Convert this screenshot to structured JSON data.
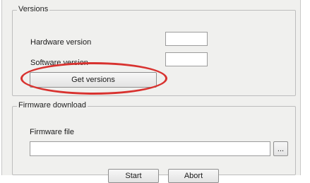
{
  "versions_group": {
    "title": "Versions",
    "hardware_label": "Hardware version",
    "hardware_value": "",
    "software_label": "Software version",
    "software_value": "",
    "get_versions_label": "Get versions"
  },
  "firmware_group": {
    "title": "Firmware download",
    "file_label": "Firmware file",
    "file_value": "",
    "browse_label": "...",
    "start_label": "Start",
    "abort_label": "Abort"
  },
  "annotation": {
    "highlight_color": "#d8322f",
    "highlight_target": "Get versions"
  }
}
